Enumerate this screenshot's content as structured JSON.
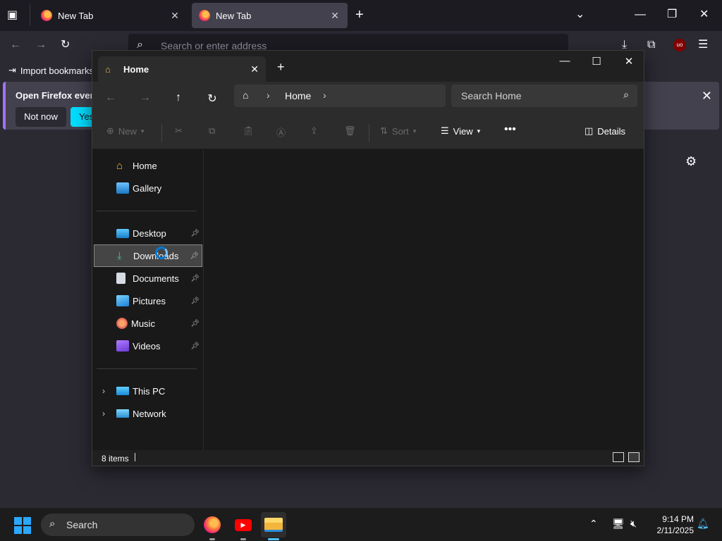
{
  "firefox": {
    "tabs": [
      {
        "title": "New Tab",
        "active": false
      },
      {
        "title": "New Tab",
        "active": true
      }
    ],
    "urlbar_placeholder": "Search or enter address",
    "bookmarks": {
      "import_label": "Import bookmarks"
    },
    "notification": {
      "message": "Open Firefox every",
      "not_now": "Not now",
      "yes": "Yes,"
    }
  },
  "explorer": {
    "tab_title": "Home",
    "breadcrumb": "Home",
    "search_placeholder": "Search Home",
    "commands": {
      "new": "New",
      "sort": "Sort",
      "view": "View",
      "details": "Details"
    },
    "nav": {
      "top": [
        {
          "label": "Home",
          "icon": "home-icon"
        },
        {
          "label": "Gallery",
          "icon": "gallery-icon"
        }
      ],
      "quick_access": [
        {
          "label": "Desktop",
          "icon": "desktop-icon",
          "pinned": true,
          "selected": false
        },
        {
          "label": "Downloads",
          "icon": "download-icon",
          "pinned": true,
          "selected": true
        },
        {
          "label": "Documents",
          "icon": "documents-icon",
          "pinned": true,
          "selected": false
        },
        {
          "label": "Pictures",
          "icon": "pictures-icon",
          "pinned": true,
          "selected": false
        },
        {
          "label": "Music",
          "icon": "music-icon",
          "pinned": true,
          "selected": false
        },
        {
          "label": "Videos",
          "icon": "videos-icon",
          "pinned": true,
          "selected": false
        }
      ],
      "locations": [
        {
          "label": "This PC",
          "icon": "computer-icon"
        },
        {
          "label": "Network",
          "icon": "network-icon"
        }
      ]
    },
    "status": {
      "item_count": "8 items"
    }
  },
  "taskbar": {
    "search_label": "Search",
    "clock": {
      "time": "9:14 PM",
      "date": "2/11/2025"
    }
  },
  "colors": {
    "accent": "#0078d4",
    "firefox_cyan": "#00ddff",
    "start_blue": "#2aa7ff"
  }
}
